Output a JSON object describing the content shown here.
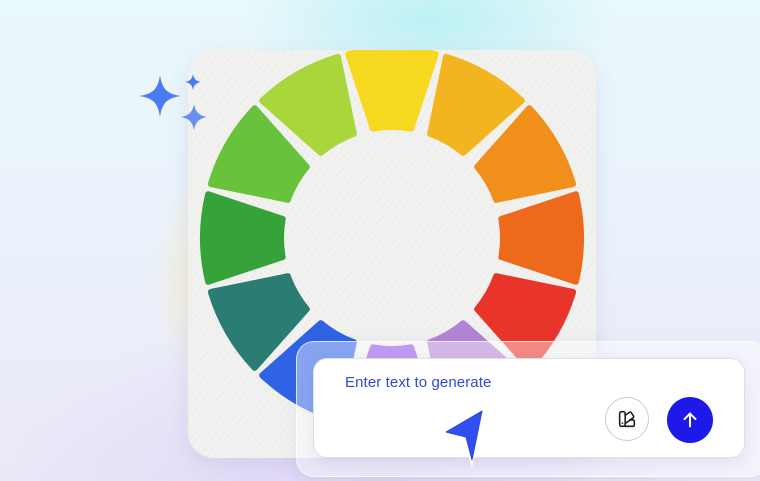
{
  "prompt": {
    "placeholder": "Enter text to generate"
  },
  "icons": {
    "sparkles": "sparkles-icon",
    "style": "style-palette-icon",
    "send": "arrow-up-icon",
    "cursor": "pointer-cursor-icon"
  },
  "color_wheel": {
    "segments": 12,
    "colors": [
      "#f5d81f",
      "#f2b51f",
      "#f0901b",
      "#ed6a1d",
      "#e9342a",
      "#b383d4",
      "#8e53e8",
      "#2f63e6",
      "#2a7d73",
      "#36a33a",
      "#68c23b",
      "#a9d63a"
    ]
  },
  "colors": {
    "accent": "#1d19e8",
    "placeholder_text": "#2f49d9",
    "sparkle": "#4a7cf0"
  }
}
